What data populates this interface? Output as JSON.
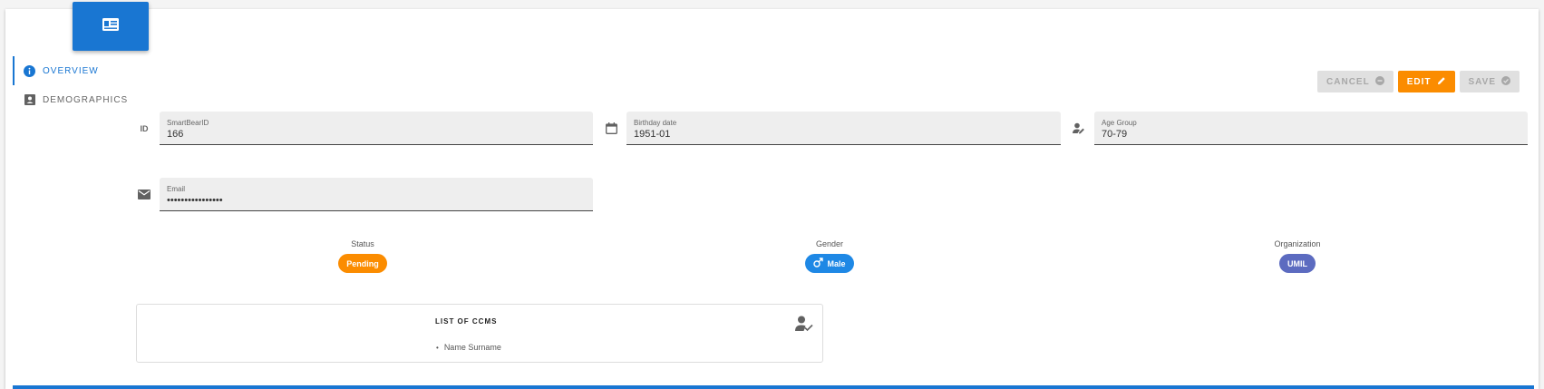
{
  "header": {
    "icon": "contact-card-icon"
  },
  "nav": {
    "items": [
      {
        "label": "OVERVIEW",
        "icon": "info-icon"
      },
      {
        "label": "DEMOGRAPHICS",
        "icon": "account-box-icon"
      }
    ]
  },
  "toolbar": {
    "cancel_label": "CANCEL",
    "edit_label": "EDIT",
    "save_label": "SAVE"
  },
  "fields": {
    "smartbear": {
      "label": "SmartBearID",
      "value": "166",
      "icon_text": "ID"
    },
    "birthday": {
      "label": "Birthday date",
      "value": "1951-01"
    },
    "age_group": {
      "label": "Age Group",
      "value": "70-79"
    },
    "email": {
      "label": "Email",
      "value": "••••••••••••••••"
    }
  },
  "status": {
    "label": "Status",
    "value": "Pending",
    "color": "#fb8c00"
  },
  "gender": {
    "label": "Gender",
    "value": "Male",
    "color": "#1e88e5"
  },
  "organization": {
    "label": "Organization",
    "value": "UMIL",
    "color": "#5c6bc0"
  },
  "ccms": {
    "title": "LIST OF CCMS",
    "items": [
      "Name Surname"
    ]
  },
  "colors": {
    "accent": "#1976d2",
    "edit": "#fb8c00"
  }
}
